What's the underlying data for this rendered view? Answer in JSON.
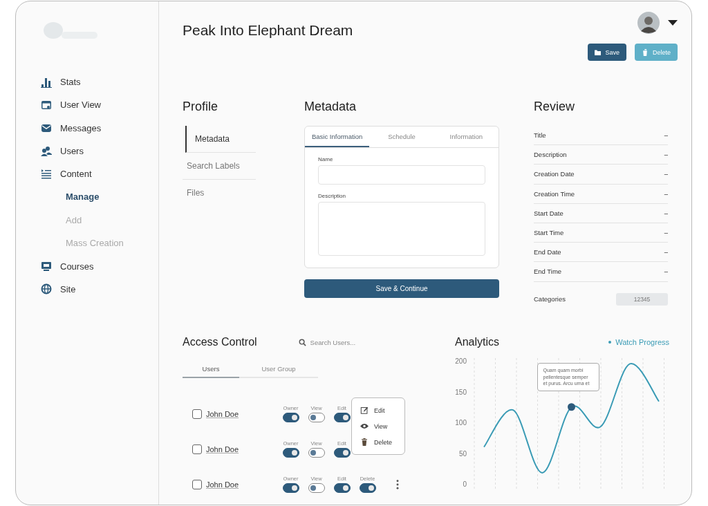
{
  "header": {
    "title": "Peak Into Elephant Dream",
    "buttons": [
      {
        "label": "Save",
        "kind": "primary"
      },
      {
        "label": "Delete",
        "kind": "danger"
      }
    ]
  },
  "sidebar": {
    "items": [
      {
        "label": "Stats"
      },
      {
        "label": "User View"
      },
      {
        "label": "Messages"
      },
      {
        "label": "Users"
      },
      {
        "label": "Content",
        "children": [
          {
            "label": "Manage",
            "selected": true
          },
          {
            "label": "Add",
            "selected": false
          },
          {
            "label": "Mass Creation",
            "selected": false
          }
        ]
      },
      {
        "label": "Courses"
      },
      {
        "label": "Site"
      }
    ]
  },
  "profile": {
    "title": "Profile",
    "items": [
      {
        "label": "Metadata",
        "selected": true
      },
      {
        "label": "Search Labels",
        "selected": false
      },
      {
        "label": "Files",
        "selected": false
      }
    ]
  },
  "metadata": {
    "title": "Metadata",
    "tabs": [
      {
        "label": "Basic Information",
        "selected": true
      },
      {
        "label": "Schedule",
        "selected": false
      },
      {
        "label": "Information",
        "selected": false
      }
    ],
    "fields": [
      {
        "label": "Name",
        "kind": "input"
      },
      {
        "label": "Description",
        "kind": "textarea"
      }
    ],
    "submit": "Save & Continue"
  },
  "review": {
    "title": "Review",
    "rows": [
      {
        "label": "Title",
        "value": "–"
      },
      {
        "label": "Description",
        "value": "–"
      },
      {
        "label": "Creation Date",
        "value": "–"
      },
      {
        "label": "Creation Time",
        "value": "–"
      },
      {
        "label": "Start Date",
        "value": "–"
      },
      {
        "label": "Start Time",
        "value": "–"
      },
      {
        "label": "End Date",
        "value": "–"
      },
      {
        "label": "End Time",
        "value": "–"
      }
    ],
    "categories": {
      "label": "Categories",
      "value": "12345"
    }
  },
  "access_control": {
    "title": "Access Control",
    "search": {
      "placeholder": "Search Users..."
    },
    "tabs": [
      {
        "label": "Users",
        "selected": true
      },
      {
        "label": "User Group",
        "selected": false
      }
    ],
    "rows": [
      {
        "name": "John Doe",
        "checked": false,
        "permissions": [
          {
            "label": "Owner",
            "on": true
          },
          {
            "label": "View",
            "on": false
          },
          {
            "label": "Edit",
            "on": true
          }
        ]
      },
      {
        "name": "John Doe",
        "checked": false,
        "permissions": [
          {
            "label": "Owner",
            "on": true
          },
          {
            "label": "View",
            "on": false
          },
          {
            "label": "Edit",
            "on": true
          }
        ]
      },
      {
        "name": "John Doe",
        "checked": false,
        "permissions": [
          {
            "label": "Owner",
            "on": true
          },
          {
            "label": "View",
            "on": false
          },
          {
            "label": "Edit",
            "on": true
          },
          {
            "label": "Delete",
            "on": true
          }
        ]
      }
    ],
    "menu": [
      {
        "label": "Edit",
        "kind": "edit"
      },
      {
        "label": "View",
        "kind": "view"
      },
      {
        "label": "Delete",
        "kind": "delete"
      }
    ]
  },
  "analytics": {
    "title": "Analytics",
    "chart_data": {
      "type": "line",
      "ylim": [
        0,
        200
      ],
      "yticks": [
        0,
        50,
        100,
        150,
        200
      ],
      "series": [
        {
          "name": "Watch Progress",
          "color": "#3a9bb5",
          "values": [
            60,
            120,
            18,
            125,
            93,
            195,
            134
          ]
        }
      ],
      "annotations": [
        "Quam quam morbi pellentesque semper et purus. Arcu urna et"
      ]
    }
  }
}
